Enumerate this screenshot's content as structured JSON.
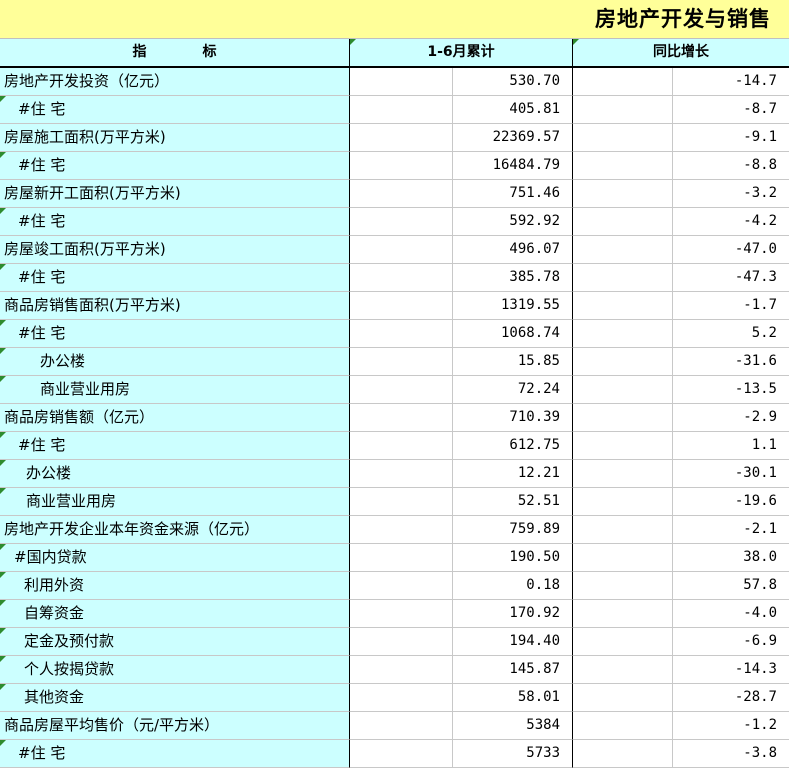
{
  "title": "房地产开发与销售",
  "header": {
    "indicator": "指　　　　标",
    "cumulative": "1-6月累计",
    "yoy": "同比增长"
  },
  "rows": [
    {
      "name": "房地产开发投资（亿元）",
      "value": "530.70",
      "yoy": "-14.7",
      "indent": 0,
      "mark": false
    },
    {
      "name": "#住 宅",
      "value": "405.81",
      "yoy": "-8.7",
      "indent": 1,
      "mark": true
    },
    {
      "name": "房屋施工面积(万平方米)",
      "value": "22369.57",
      "yoy": "-9.1",
      "indent": 0,
      "mark": false
    },
    {
      "name": "#住 宅",
      "value": "16484.79",
      "yoy": "-8.8",
      "indent": 1,
      "mark": true
    },
    {
      "name": "房屋新开工面积(万平方米)",
      "value": "751.46",
      "yoy": "-3.2",
      "indent": 0,
      "mark": false
    },
    {
      "name": "#住 宅",
      "value": "592.92",
      "yoy": "-4.2",
      "indent": 1,
      "mark": true
    },
    {
      "name": "房屋竣工面积(万平方米)",
      "value": "496.07",
      "yoy": "-47.0",
      "indent": 0,
      "mark": false
    },
    {
      "name": "#住 宅",
      "value": "385.78",
      "yoy": "-47.3",
      "indent": 1,
      "mark": true
    },
    {
      "name": "商品房销售面积(万平方米)",
      "value": "1319.55",
      "yoy": "-1.7",
      "indent": 0,
      "mark": false
    },
    {
      "name": "#住 宅",
      "value": "1068.74",
      "yoy": "5.2",
      "indent": 1,
      "mark": true
    },
    {
      "name": "办公楼",
      "value": "15.85",
      "yoy": "-31.6",
      "indent": 2,
      "mark": true
    },
    {
      "name": "商业营业用房",
      "value": "72.24",
      "yoy": "-13.5",
      "indent": 2,
      "mark": true
    },
    {
      "name": "商品房销售额（亿元）",
      "value": "710.39",
      "yoy": "-2.9",
      "indent": 0,
      "mark": false
    },
    {
      "name": "#住 宅",
      "value": "612.75",
      "yoy": "1.1",
      "indent": 1,
      "mark": true
    },
    {
      "name": "办公楼",
      "value": "12.21",
      "yoy": "-30.1",
      "indent": 3,
      "mark": true
    },
    {
      "name": "商业营业用房",
      "value": "52.51",
      "yoy": "-19.6",
      "indent": 3,
      "mark": true
    },
    {
      "name": "房地产开发企业本年资金来源（亿元）",
      "value": "759.89",
      "yoy": "-2.1",
      "indent": 0,
      "mark": false
    },
    {
      "name": "#国内贷款",
      "value": "190.50",
      "yoy": "38.0",
      "indent": 4,
      "mark": true
    },
    {
      "name": "利用外资",
      "value": "0.18",
      "yoy": "57.8",
      "indent": 5,
      "mark": true
    },
    {
      "name": "自筹资金",
      "value": "170.92",
      "yoy": "-4.0",
      "indent": 5,
      "mark": true
    },
    {
      "name": "定金及预付款",
      "value": "194.40",
      "yoy": "-6.9",
      "indent": 5,
      "mark": true
    },
    {
      "name": "个人按揭贷款",
      "value": "145.87",
      "yoy": "-14.3",
      "indent": 5,
      "mark": true
    },
    {
      "name": "其他资金",
      "value": "58.01",
      "yoy": "-28.7",
      "indent": 5,
      "mark": true
    },
    {
      "name": "商品房屋平均售价（元/平方米）",
      "value": "5384",
      "yoy": "-1.2",
      "indent": 0,
      "mark": false
    },
    {
      "name": "#住 宅",
      "value": "5733",
      "yoy": "-3.8",
      "indent": 1,
      "mark": true
    }
  ]
}
